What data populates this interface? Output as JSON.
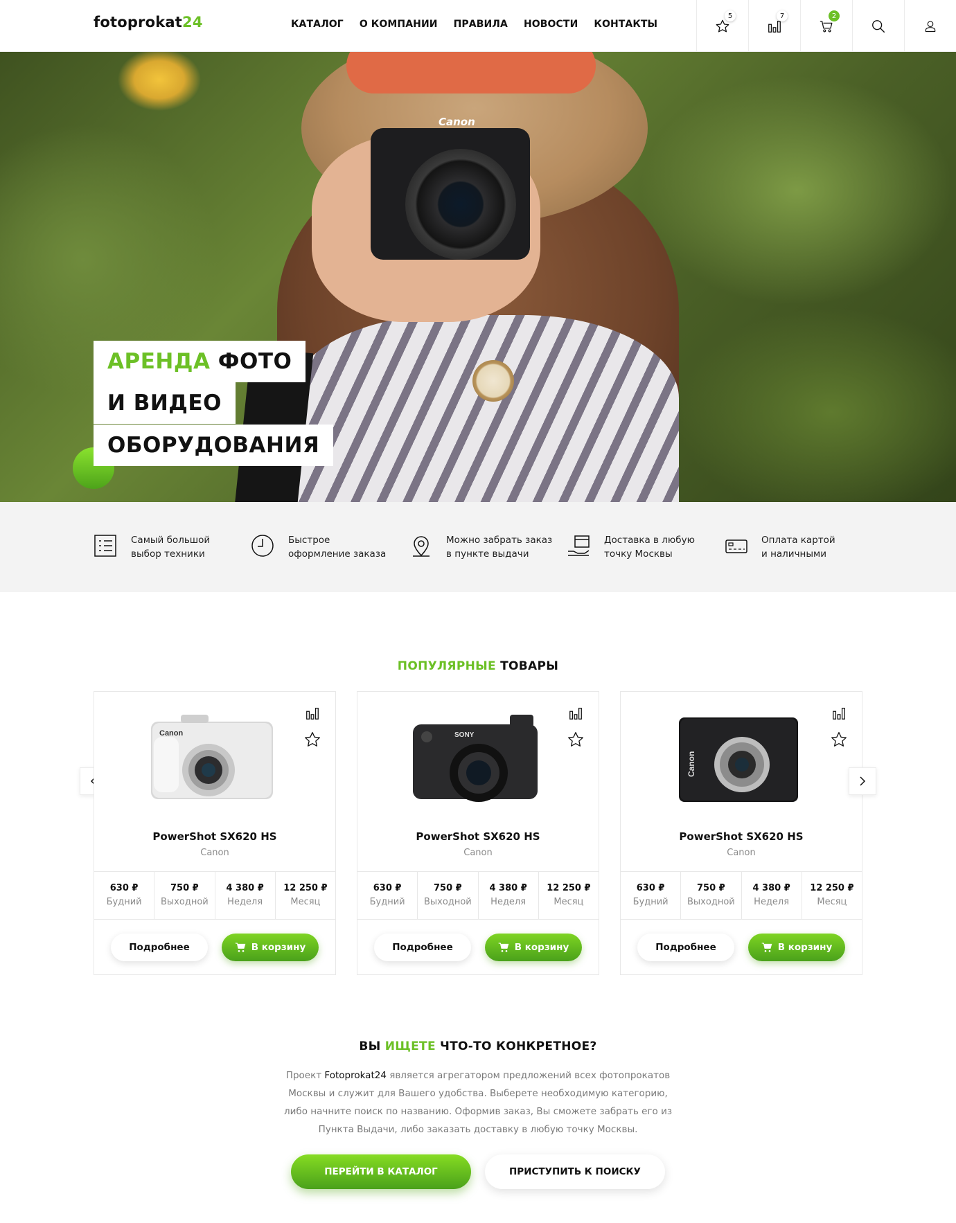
{
  "header": {
    "logo_text": "fotoprokat",
    "logo_num": "24",
    "nav": [
      "КАТАЛОГ",
      "О КОМПАНИИ",
      "ПРАВИЛА",
      "НОВОСТИ",
      "КОНТАКТЫ"
    ],
    "favorites_count": "5",
    "compare_count": "7",
    "cart_count": "2",
    "accent": "#6cc026"
  },
  "hero": {
    "line1_green": "АРЕНДА",
    "line1_rest": " ФОТО",
    "line2": "И ВИДЕО",
    "line3": "ОБОРУДОВАНИЯ",
    "camera_brand": "Canon"
  },
  "features": [
    {
      "icon": "list-icon",
      "text": "Самый большой\nвыбор техники"
    },
    {
      "icon": "clock-icon",
      "text": "Быстрое\nоформление заказа"
    },
    {
      "icon": "location-pin-icon",
      "text": "Можно забрать заказ\nв пункте выдачи"
    },
    {
      "icon": "delivery-box-icon",
      "text": "Доставка в любую\nточку Москвы"
    },
    {
      "icon": "payment-card-icon",
      "text": "Оплата картой\nи наличными"
    }
  ],
  "popular": {
    "title_green": "ПОПУЛЯРНЫЕ",
    "title_rest": " ТОВАРЫ",
    "products": [
      {
        "name": "PowerShot SX620 HS",
        "brand": "Canon",
        "image": "silver-compact-camera",
        "prices": [
          {
            "value": "630 ₽",
            "label": "Будний"
          },
          {
            "value": "750 ₽",
            "label": "Выходной"
          },
          {
            "value": "4 380 ₽",
            "label": "Неделя"
          },
          {
            "value": "12 250 ₽",
            "label": "Месяц"
          }
        ],
        "more_label": "Подробнее",
        "cart_label": "В корзину"
      },
      {
        "name": "PowerShot SX620 HS",
        "brand": "Canon",
        "image": "black-mirrorless-camera",
        "prices": [
          {
            "value": "630 ₽",
            "label": "Будний"
          },
          {
            "value": "750 ₽",
            "label": "Выходной"
          },
          {
            "value": "4 380 ₽",
            "label": "Неделя"
          },
          {
            "value": "12 250 ₽",
            "label": "Месяц"
          }
        ],
        "more_label": "Подробнее",
        "cart_label": "В корзину"
      },
      {
        "name": "PowerShot SX620 HS",
        "brand": "Canon",
        "image": "black-compact-camera",
        "prices": [
          {
            "value": "630 ₽",
            "label": "Будний"
          },
          {
            "value": "750 ₽",
            "label": "Выходной"
          },
          {
            "value": "4 380 ₽",
            "label": "Неделя"
          },
          {
            "value": "12 250 ₽",
            "label": "Месяц"
          }
        ],
        "more_label": "Подробнее",
        "cart_label": "В корзину"
      }
    ]
  },
  "search_section": {
    "title_a": "ВЫ ",
    "title_green": "ИЩЕТЕ",
    "title_b": " ЧТО-ТО КОНКРЕТНОЕ?",
    "text_before": "Проект ",
    "text_highlight": "Fotoprokat24",
    "text_after": " является агрегатором предложений всех фотопрокатов Москвы и служит для Вашего удобства. Выберете необходимую категорию, либо начните поиск по названию. Оформив заказ, Вы сможете забрать его из Пункта Выдачи, либо заказать доставку в любую точку Москвы.",
    "catalog_button": "ПЕРЕЙТИ В КАТАЛОГ",
    "search_button": "ПРИСТУПИТЬ К ПОИСКУ"
  }
}
